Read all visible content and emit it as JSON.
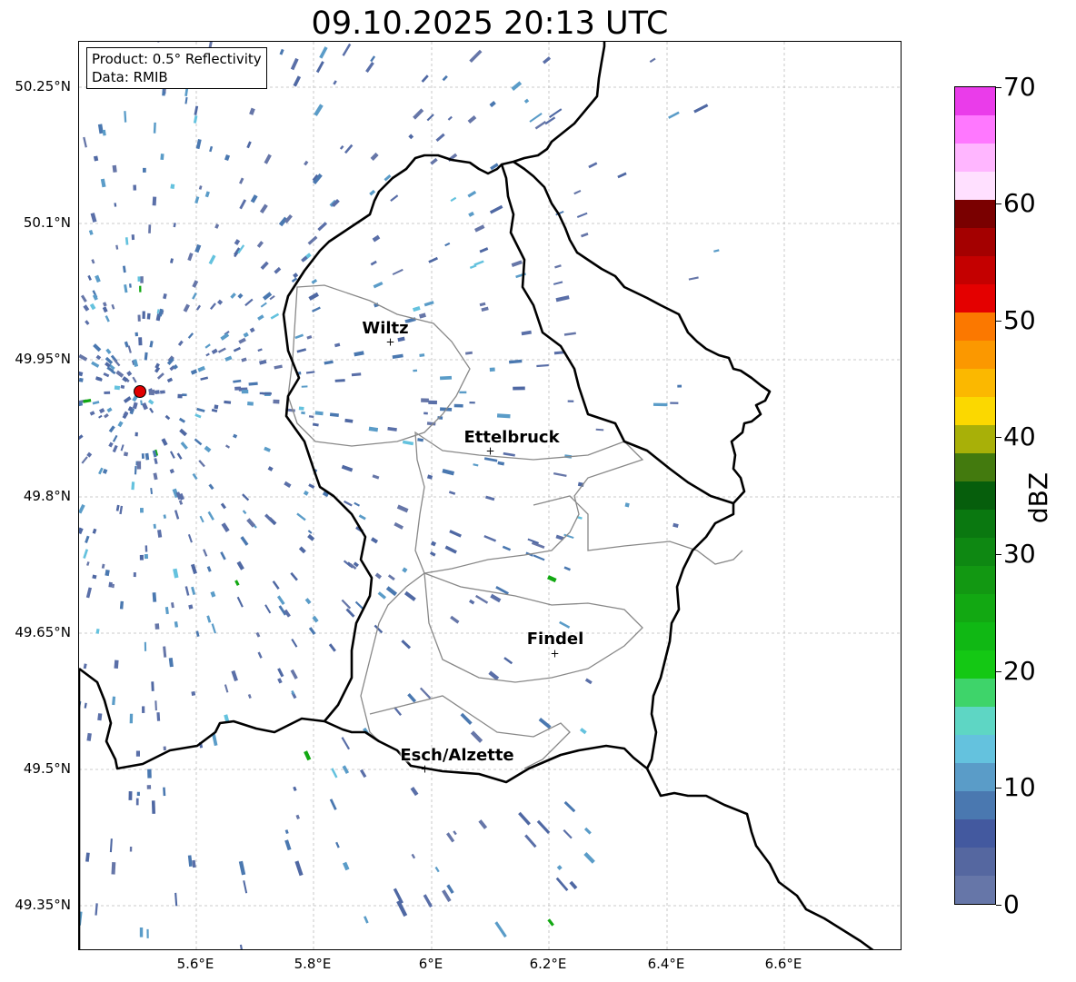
{
  "title": "09.10.2025 20:13 UTC",
  "info": {
    "product": "Product: 0.5° Reflectivity",
    "data": "Data: RMIB"
  },
  "lat_ticks": [
    "50.25°N",
    "50.1°N",
    "49.95°N",
    "49.8°N",
    "49.65°N",
    "49.5°N",
    "49.35°N"
  ],
  "lon_ticks": [
    "5.6°E",
    "5.8°E",
    "6°E",
    "6.2°E",
    "6.4°E",
    "6.6°E"
  ],
  "cities": [
    {
      "name": "Wiltz",
      "lon": 5.93,
      "lat": 49.966
    },
    {
      "name": "Ettelbruck",
      "lon": 6.1,
      "lat": 49.848
    },
    {
      "name": "Findel",
      "lon": 6.21,
      "lat": 49.627
    },
    {
      "name": "Esch/Alzette",
      "lon": 5.985,
      "lat": 49.499
    }
  ],
  "radar_site": {
    "lon": 5.505,
    "lat": 49.915
  },
  "extent": {
    "lon": [
      5.4,
      6.8
    ],
    "lat": [
      49.3,
      50.3
    ]
  },
  "colorbar": {
    "unit": "dBZ",
    "min": 0,
    "max": 70,
    "tick_labels": [
      "0",
      "10",
      "20",
      "30",
      "40",
      "50",
      "60",
      "70"
    ],
    "colors": [
      "#6676a8",
      "#5567a0",
      "#43599f",
      "#4a78b0",
      "#5a9cc8",
      "#64c2de",
      "#5ed6c4",
      "#3ed46a",
      "#14c814",
      "#10b814",
      "#12a812",
      "#129812",
      "#0e8812",
      "#0a7810",
      "#065e0c",
      "#437a0e",
      "#a8b008",
      "#fbd800",
      "#fbb800",
      "#fb9800",
      "#fb7800",
      "#e40000",
      "#c40000",
      "#a40000",
      "#7a0000",
      "#ffe0ff",
      "#ffb6ff",
      "#ff78ff",
      "#ea3cea"
    ]
  }
}
